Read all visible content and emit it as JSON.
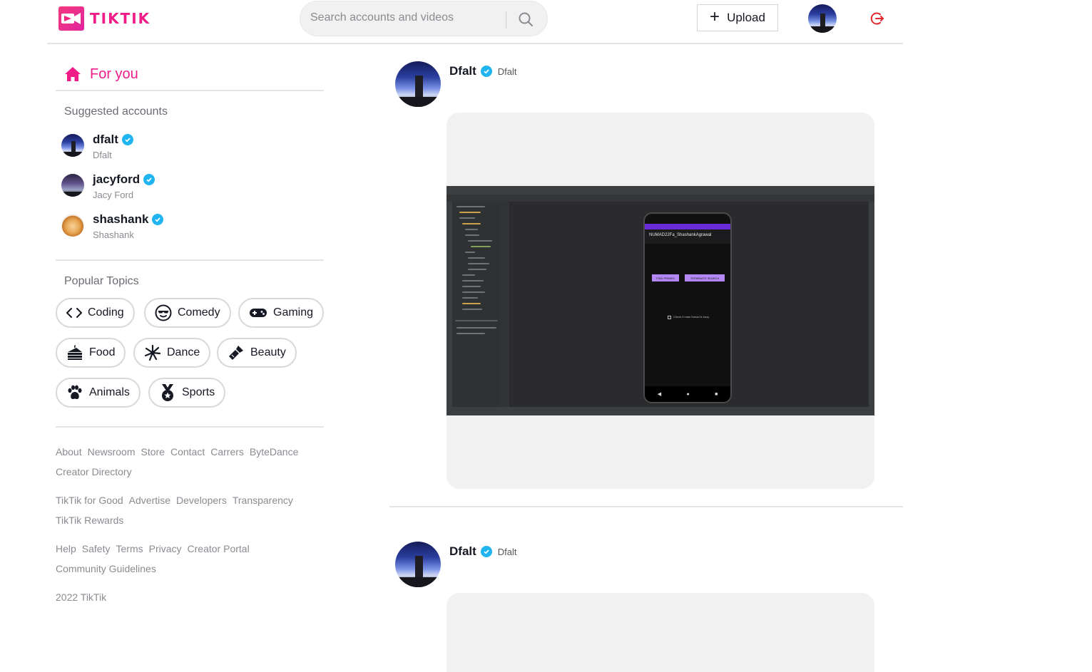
{
  "brand": {
    "name": "TIKTIK",
    "color": "#f01c88"
  },
  "search": {
    "placeholder": "Search accounts and videos",
    "value": "",
    "icon": "search-icon"
  },
  "header": {
    "upload_label": "Upload",
    "upload_icon": "plus-icon",
    "logout_icon": "logout-icon",
    "logout_color": "#e0282e"
  },
  "sidebar": {
    "for_you_label": "For you",
    "suggested_title": "Suggested accounts",
    "accounts": [
      {
        "username": "dfalt",
        "display_name": "Dfalt",
        "verified": true
      },
      {
        "username": "jacyford",
        "display_name": "Jacy Ford",
        "verified": true
      },
      {
        "username": "shashank",
        "display_name": "Shashank",
        "verified": true
      }
    ],
    "topics_title": "Popular Topics",
    "topics": [
      {
        "label": "Coding",
        "icon": "code-icon"
      },
      {
        "label": "Comedy",
        "icon": "cool-face-icon"
      },
      {
        "label": "Gaming",
        "icon": "gamepad-icon"
      },
      {
        "label": "Food",
        "icon": "cake-icon"
      },
      {
        "label": "Dance",
        "icon": "dance-icon"
      },
      {
        "label": "Beauty",
        "icon": "lipstick-icon"
      },
      {
        "label": "Animals",
        "icon": "paw-icon"
      },
      {
        "label": "Sports",
        "icon": "medal-icon"
      }
    ],
    "footer": {
      "line1": [
        "About",
        "Newsroom",
        "Store",
        "Contact",
        "Carrers",
        "ByteDance",
        "Creator Directory"
      ],
      "line2": [
        "TikTik for Good",
        "Advertise",
        "Developers",
        "Transparency",
        "TikTik Rewards"
      ],
      "line3": [
        "Help",
        "Safety",
        "Terms",
        "Privacy",
        "Creator Portal",
        "Community Guidelines"
      ],
      "copyright": "2022 TikTik"
    }
  },
  "feed": {
    "posts": [
      {
        "username": "Dfalt",
        "display_name": "Dfalt",
        "verified": true,
        "video": {
          "phone_title": "NUMAD22Fa_ShashankAgrawal",
          "buttons": [
            "FIND PRIMES",
            "TERMINATE SEARCH"
          ],
          "checkbox_label": "Check if main thread is busy"
        }
      },
      {
        "username": "Dfalt",
        "display_name": "Dfalt",
        "verified": true
      }
    ]
  },
  "colors": {
    "accent": "#f01c88",
    "verified": "#20b5f0",
    "card_bg": "#f1f1f2"
  }
}
